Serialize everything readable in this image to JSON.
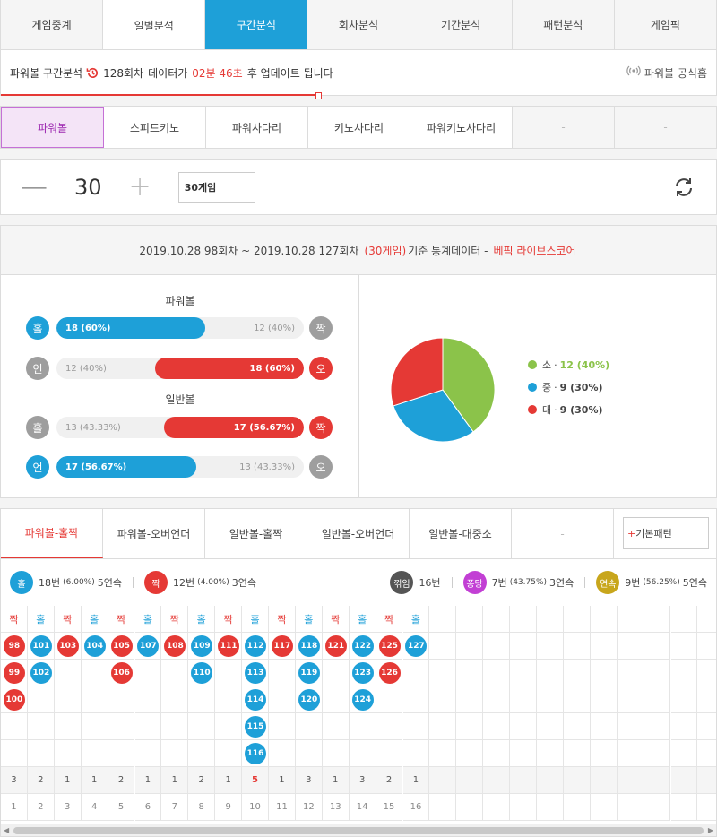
{
  "top_tabs": [
    {
      "label": "게임중계",
      "state": ""
    },
    {
      "label": "일별분석",
      "state": "sel"
    },
    {
      "label": "구간분석",
      "state": "act"
    },
    {
      "label": "회차분석",
      "state": ""
    },
    {
      "label": "기간분석",
      "state": ""
    },
    {
      "label": "패턴분석",
      "state": ""
    },
    {
      "label": "게임픽",
      "state": ""
    }
  ],
  "info": {
    "prefix": "파워볼 구간분석",
    "round": "128회차",
    "mid": "데이터가",
    "time": "02분 46초",
    "suffix": "후 업데이트 됩니다",
    "official": "파워볼 공식홈"
  },
  "game_tabs": [
    {
      "label": "파워볼",
      "state": "act"
    },
    {
      "label": "스피드키노",
      "state": ""
    },
    {
      "label": "파워사다리",
      "state": ""
    },
    {
      "label": "키노사다리",
      "state": ""
    },
    {
      "label": "파워키노사다리",
      "state": ""
    },
    {
      "label": "-",
      "state": "dis"
    },
    {
      "label": "-",
      "state": "dis"
    }
  ],
  "counter": {
    "minus": "—",
    "value": "30",
    "plus": "+",
    "select": "30게임"
  },
  "stats": {
    "range": "2019.10.28 98회차 ~ 2019.10.28 127회차",
    "games": "(30게임)",
    "mid": "기준 통계데이터 -",
    "brand": "베픽 라이브스코어",
    "powerball_title": "파워볼",
    "normal_title": "일반볼",
    "rows": [
      {
        "left": "홀",
        "lc": "c-blue",
        "right": "짝",
        "rc": "c-gray",
        "side": "l",
        "fill_label": "18 (60%)",
        "rest_label": "12 (40%)",
        "fill_pct": 0.6,
        "color": "#1ea0d8"
      },
      {
        "left": "언",
        "lc": "c-gray",
        "right": "오",
        "rc": "c-red",
        "side": "r",
        "fill_label": "18 (60%)",
        "rest_label": "12 (40%)",
        "fill_pct": 0.6,
        "color": "#e53935"
      },
      {
        "left": "홀",
        "lc": "c-gray",
        "right": "짝",
        "rc": "c-red",
        "side": "r",
        "fill_label": "17 (56.67%)",
        "rest_label": "13 (43.33%)",
        "fill_pct": 0.5667,
        "color": "#e53935"
      },
      {
        "left": "언",
        "lc": "c-blue",
        "right": "오",
        "rc": "c-gray",
        "side": "l",
        "fill_label": "17 (56.67%)",
        "rest_label": "13 (43.33%)",
        "fill_pct": 0.5667,
        "color": "#1ea0d8"
      }
    ],
    "pie": [
      {
        "label": "소",
        "value": "12 (40%)",
        "count": 12,
        "color": "#8bc34a"
      },
      {
        "label": "중",
        "value": "9 (30%)",
        "count": 9,
        "color": "#1ea0d8"
      },
      {
        "label": "대",
        "value": "9 (30%)",
        "count": 9,
        "color": "#e53935"
      }
    ]
  },
  "pattern_tabs": [
    {
      "label": "파워볼-홀짝",
      "state": "act"
    },
    {
      "label": "파워볼-오버언더",
      "state": ""
    },
    {
      "label": "일반볼-홀짝",
      "state": ""
    },
    {
      "label": "일반볼-오버언더",
      "state": ""
    },
    {
      "label": "일반볼-대중소",
      "state": ""
    },
    {
      "label": "-",
      "state": "dis"
    }
  ],
  "pattern_button": {
    "plus": "+",
    "label": "기본패턴"
  },
  "summary": {
    "odd": {
      "icon": "홀",
      "text": "18번",
      "small": "(6.00%)",
      "streak": "5연속"
    },
    "even": {
      "icon": "짝",
      "text": "12번",
      "small": "(4.00%)",
      "streak": "3연속"
    },
    "flip": {
      "icon": "꺾임",
      "text": "16번"
    },
    "pong": {
      "icon": "퐁당",
      "text": "7번",
      "small": "(43.75%)",
      "streak": "3연속"
    },
    "cont": {
      "icon": "연속",
      "text": "9번",
      "small": "(56.25%)",
      "streak": "5연속"
    }
  },
  "columns": [
    {
      "head": "짝",
      "balls": [
        "98",
        "99",
        "100"
      ],
      "count": "3",
      "idx": "1"
    },
    {
      "head": "홀",
      "balls": [
        "101",
        "102"
      ],
      "count": "2",
      "idx": "2"
    },
    {
      "head": "짝",
      "balls": [
        "103"
      ],
      "count": "1",
      "idx": "3"
    },
    {
      "head": "홀",
      "balls": [
        "104"
      ],
      "count": "1",
      "idx": "4"
    },
    {
      "head": "짝",
      "balls": [
        "105",
        "106"
      ],
      "count": "2",
      "idx": "5"
    },
    {
      "head": "홀",
      "balls": [
        "107"
      ],
      "count": "1",
      "idx": "6"
    },
    {
      "head": "짝",
      "balls": [
        "108"
      ],
      "count": "1",
      "idx": "7"
    },
    {
      "head": "홀",
      "balls": [
        "109",
        "110"
      ],
      "count": "2",
      "idx": "8"
    },
    {
      "head": "짝",
      "balls": [
        "111"
      ],
      "count": "1",
      "idx": "9"
    },
    {
      "head": "홀",
      "balls": [
        "112",
        "113",
        "114",
        "115",
        "116"
      ],
      "count": "5",
      "idx": "10"
    },
    {
      "head": "짝",
      "balls": [
        "117"
      ],
      "count": "1",
      "idx": "11"
    },
    {
      "head": "홀",
      "balls": [
        "118",
        "119",
        "120"
      ],
      "count": "3",
      "idx": "12"
    },
    {
      "head": "짝",
      "balls": [
        "121"
      ],
      "count": "1",
      "idx": "13"
    },
    {
      "head": "홀",
      "balls": [
        "122",
        "123",
        "124"
      ],
      "count": "3",
      "idx": "14"
    },
    {
      "head": "짝",
      "balls": [
        "125",
        "126"
      ],
      "count": "2",
      "idx": "15"
    },
    {
      "head": "홀",
      "balls": [
        "127"
      ],
      "count": "1",
      "idx": "16"
    }
  ],
  "colors": {
    "odd": "#1ea0d8",
    "even": "#e53935",
    "accent": "#1ea0d8"
  },
  "icons": {
    "clock": "history-icon",
    "official": "broadcast-icon",
    "refresh": "refresh-icon"
  }
}
